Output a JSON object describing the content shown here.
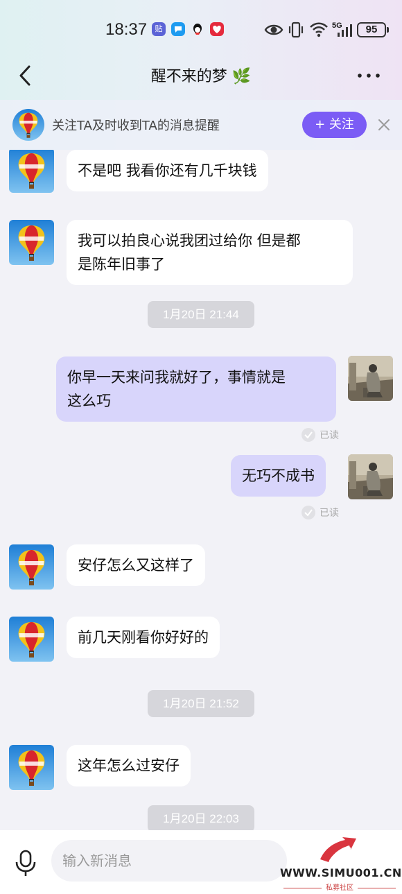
{
  "status_bar": {
    "time": "18:37",
    "notification_icons": [
      "tieba-icon",
      "message-icon",
      "qq-icon",
      "app-heart-icon"
    ],
    "network": "5G",
    "battery": "95"
  },
  "nav": {
    "title": "醒不来的梦",
    "title_emoji": "🌿"
  },
  "follow_bar": {
    "text": "关注TA及时收到TA的消息提醒",
    "button_label": "+ 关注"
  },
  "messages": [
    {
      "type": "in",
      "text": "不是吧 我看你还有几千块钱"
    },
    {
      "type": "in",
      "text": "我可以拍良心说我团过给你 但是都\n是陈年旧事了"
    },
    {
      "type": "time",
      "text": "1月20日 21:44"
    },
    {
      "type": "out",
      "text": "你早一天来问我就好了，事情就是\n这么巧",
      "status": "已读"
    },
    {
      "type": "out",
      "text": "无巧不成书",
      "status": "已读"
    },
    {
      "type": "in",
      "text": "安仔怎么又这样了"
    },
    {
      "type": "in",
      "text": "前几天刚看你好好的"
    },
    {
      "type": "time",
      "text": "1月20日 21:52"
    },
    {
      "type": "in",
      "text": "这年怎么过安仔"
    },
    {
      "type": "time",
      "text": "1月20日 22:03"
    }
  ],
  "input": {
    "placeholder": "输入新消息"
  },
  "watermark": {
    "text": "WWW.SIMU001.CN",
    "subtext": "私募社区"
  },
  "colors": {
    "accent": "#7b5cf5",
    "outgoing_bubble": "#d8d5fb",
    "incoming_bubble": "#ffffff",
    "chat_background": "#f2f2f7",
    "timestamp_bg": "#d6d6db"
  }
}
